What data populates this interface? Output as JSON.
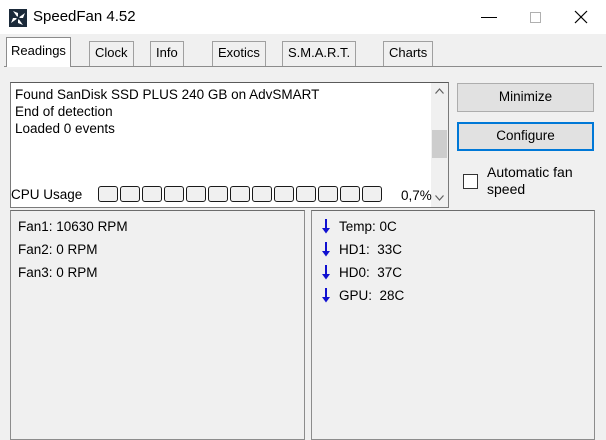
{
  "window": {
    "title": "SpeedFan 4.52",
    "icon": "speedfan-fan-icon",
    "controls": [
      "minimize-icon",
      "maximize-icon",
      "close-icon"
    ]
  },
  "tabs": [
    {
      "label": "Readings",
      "active": true
    },
    {
      "label": "Clock",
      "active": false
    },
    {
      "label": "Info",
      "active": false
    },
    {
      "label": "Exotics",
      "active": false
    },
    {
      "label": "S.M.A.R.T.",
      "active": false
    },
    {
      "label": "Charts",
      "active": false
    }
  ],
  "log": {
    "lines": [
      "Found SanDisk SSD PLUS 240 GB on AdvSMART",
      "End of detection",
      "Loaded 0 events"
    ]
  },
  "buttons": {
    "minimize": "Minimize",
    "configure": "Configure"
  },
  "auto_fan": {
    "label": "Automatic fan speed",
    "checked": false
  },
  "cpu_usage": {
    "label": "CPU Usage",
    "value": "0,7%",
    "level": 0.007,
    "cells": 13
  },
  "fans": [
    "Fan1: 10630 RPM",
    "Fan2: 0 RPM",
    "Fan3: 0 RPM"
  ],
  "temps": [
    {
      "text": "Temp: 0C",
      "trend": "down"
    },
    {
      "text": "HD1:  33C",
      "trend": "down"
    },
    {
      "text": "HD0:  37C",
      "trend": "down"
    },
    {
      "text": "GPU:  28C",
      "trend": "down"
    }
  ],
  "colors": {
    "trend_arrow": "#1010d0",
    "focus_border": "#0078d7"
  }
}
